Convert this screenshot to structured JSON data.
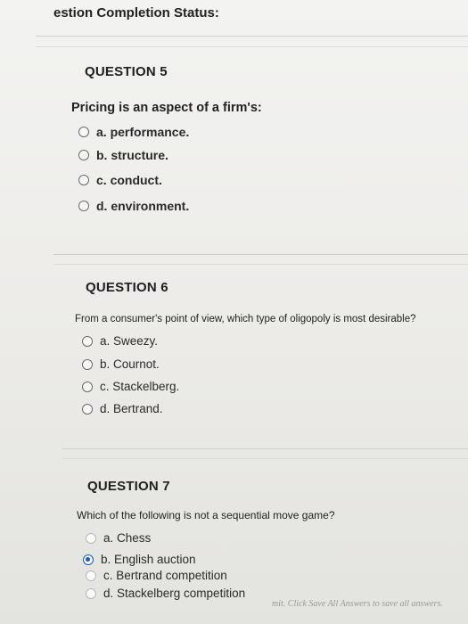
{
  "header": {
    "title": "estion Completion Status:"
  },
  "questions": [
    {
      "number": "QUESTION 5",
      "text": "Pricing is an aspect of a firm's:",
      "options": [
        {
          "label": "a. performance.",
          "selected": false
        },
        {
          "label": "b. structure.",
          "selected": false
        },
        {
          "label": "c. conduct.",
          "selected": false
        },
        {
          "label": "d. environment.",
          "selected": false
        }
      ]
    },
    {
      "number": "QUESTION 6",
      "text": "From a consumer's point of view, which type of oligopoly is most desirable?",
      "options": [
        {
          "label": "a. Sweezy.",
          "selected": false
        },
        {
          "label": "b. Cournot.",
          "selected": false
        },
        {
          "label": "c. Stackelberg.",
          "selected": false
        },
        {
          "label": "d. Bertrand.",
          "selected": false
        }
      ]
    },
    {
      "number": "QUESTION 7",
      "text": "Which of the following is not a sequential move game?",
      "options": [
        {
          "label": "a. Chess",
          "selected": false
        },
        {
          "label": "b. English auction",
          "selected": true
        },
        {
          "label": "c. Bertrand competition",
          "selected": false
        },
        {
          "label": "d. Stackelberg competition",
          "selected": false
        }
      ]
    }
  ],
  "footer": {
    "note": "mit. Click Save All Answers to save all answers."
  },
  "colors": {
    "selected_radio": "#1a57c9"
  }
}
